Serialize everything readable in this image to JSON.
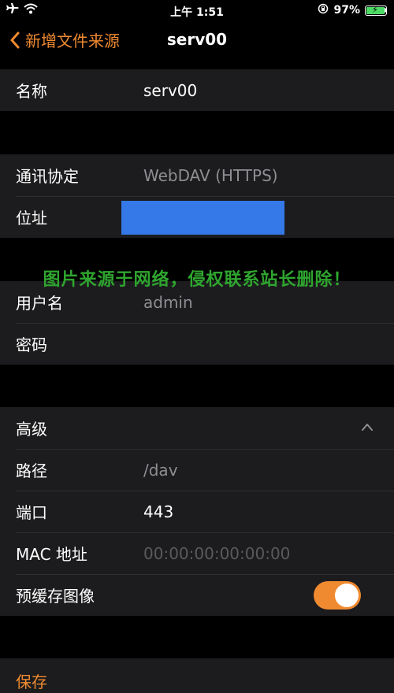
{
  "status_bar": {
    "time": "上午 1:51",
    "battery": "97%",
    "battery_level": 0.97,
    "icons": [
      "airplane-icon",
      "wifi-icon",
      "orientation-lock-icon",
      "battery-charging-icon"
    ]
  },
  "nav": {
    "back_label": "新增文件来源",
    "title": "serv00"
  },
  "basic": {
    "name_label": "名称",
    "name_value": "serv00"
  },
  "connection": {
    "protocol_label": "通讯协定",
    "protocol_value": "WebDAV (HTTPS)",
    "address_label": "位址"
  },
  "watermark": "图片来源于网络，侵权联系站长删除！",
  "credentials": {
    "username_label": "用户名",
    "username_value": "admin",
    "password_label": "密码"
  },
  "advanced": {
    "header_label": "高级",
    "path_label": "路径",
    "path_value": "/dav",
    "port_label": "端口",
    "port_value": "443",
    "mac_label": "MAC 地址",
    "mac_placeholder": "00:00:00:00:00:00",
    "precache_label": "预缓存图像",
    "precache_on": true
  },
  "actions": {
    "save_label": "保存"
  },
  "colors": {
    "accent": "#f08a30",
    "background": "#000000",
    "cell": "#1c1c1e",
    "redaction": "#3579e8",
    "watermark": "#2fa52f"
  }
}
